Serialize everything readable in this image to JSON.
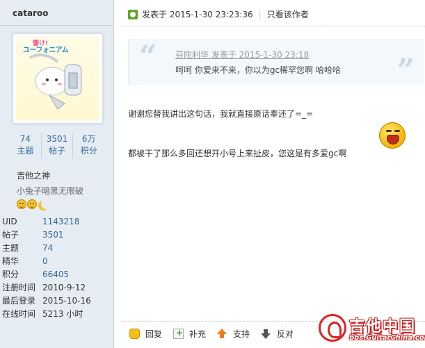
{
  "user": {
    "username": "cataroo",
    "avatar_text_top": "響け!",
    "avatar_text": "ユーフォニアム",
    "stats": [
      {
        "num": "74",
        "label": "主题"
      },
      {
        "num": "3501",
        "label": "帖子"
      },
      {
        "num": "6万",
        "label": "积分"
      }
    ],
    "rank_title": "吉他之神",
    "rank_sub": "小兔子暗黑无限破",
    "info": [
      {
        "key": "UID",
        "value": "1143218"
      },
      {
        "key": "帖子",
        "value": "3501"
      },
      {
        "key": "主题",
        "value": "74"
      },
      {
        "key": "精华",
        "value": "0"
      },
      {
        "key": "积分",
        "value": "66405"
      },
      {
        "key": "注册时间",
        "value": "2010-9-12"
      },
      {
        "key": "最后登录",
        "value": "2015-10-16"
      },
      {
        "key": "在线时间",
        "value": "5213 小时"
      }
    ]
  },
  "post": {
    "posted_at": "发表于 2015-1-30 23:23:36",
    "only_author": "只看该作者",
    "quote_author": "芬陀利华 发表于 2015-1-30 23:18",
    "quote_text": "呵呵 你爱来不来，你以为gc稀罕您啊  哈哈哈",
    "line1": "谢谢您替我讲出这句话，我就直接原话奉还了=_=",
    "line2": "都被干了那么多回还想开小号上来扯皮，您这是有多爱gc啊"
  },
  "actions": {
    "reply": "回复",
    "add": "补充",
    "support": "支持",
    "oppose": "反对"
  },
  "watermark": {
    "title": "吉他中国",
    "url": "bbs.GuitarChina.com"
  }
}
